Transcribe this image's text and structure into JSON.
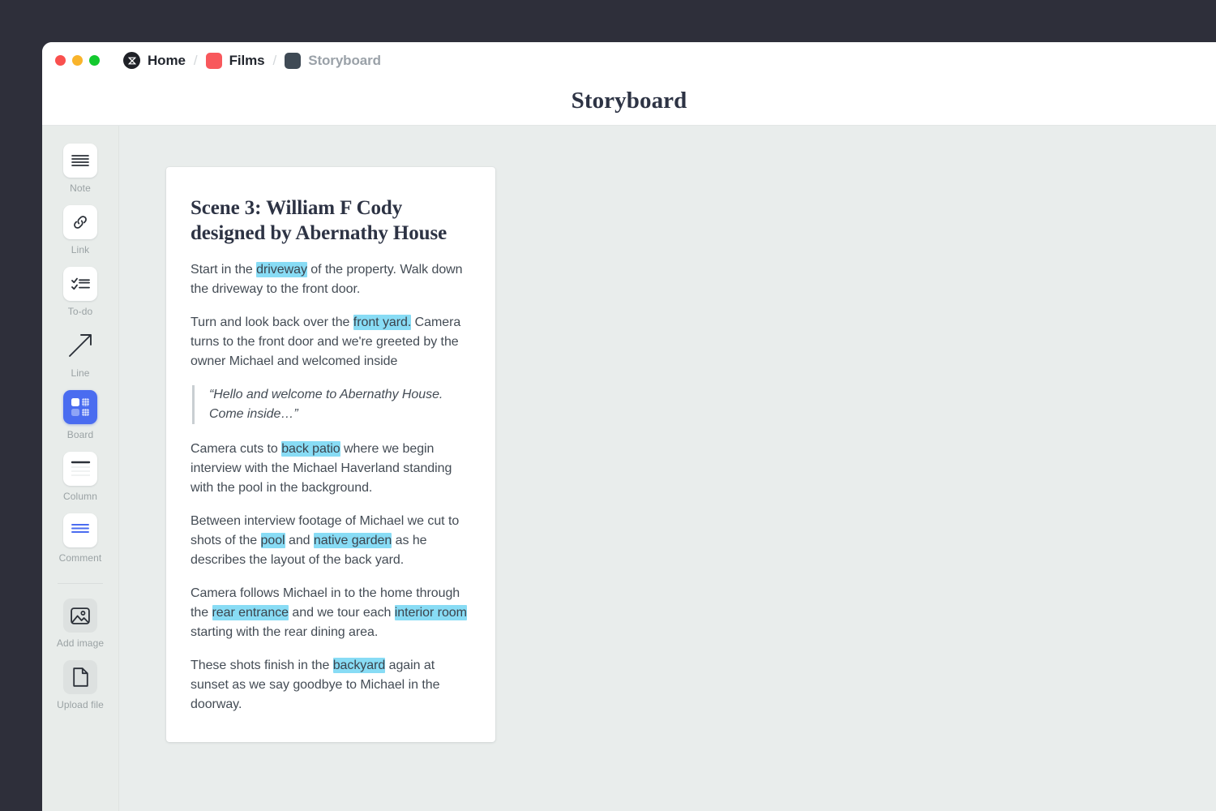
{
  "window": {
    "traffic_lights": [
      "close",
      "minimize",
      "maximize"
    ],
    "breadcrumb": [
      {
        "label": "Home",
        "icon": "home-mark-icon",
        "muted": false
      },
      {
        "label": "Films",
        "icon": "red-square-icon",
        "muted": false
      },
      {
        "label": "Storyboard",
        "icon": "slate-square-icon",
        "muted": true
      }
    ],
    "separator": "/",
    "page_title": "Storyboard"
  },
  "sidebar": {
    "tools": [
      {
        "label": "Note",
        "icon": "note-icon",
        "style": "white"
      },
      {
        "label": "Link",
        "icon": "link-icon",
        "style": "white"
      },
      {
        "label": "To-do",
        "icon": "todo-icon",
        "style": "white"
      },
      {
        "label": "Line",
        "icon": "arrow-line-icon",
        "style": "plain"
      },
      {
        "label": "Board",
        "icon": "board-icon",
        "style": "active"
      },
      {
        "label": "Column",
        "icon": "column-icon",
        "style": "white"
      },
      {
        "label": "Comment",
        "icon": "comment-icon",
        "style": "white"
      },
      {
        "label": "Add image",
        "icon": "image-icon",
        "style": "grey"
      },
      {
        "label": "Upload file",
        "icon": "file-icon",
        "style": "grey"
      }
    ]
  },
  "card": {
    "title": "Scene 3: William F Cody designed by Abernathy House",
    "p1_a": "Start in the ",
    "p1_hl": "driveway",
    "p1_b": " of the property. Walk down the driveway to the front door.",
    "p2_a": "Turn and look back over the ",
    "p2_hl": "front yard.",
    "p2_b": " Camera turns to the front door and we're greeted by the owner Michael and welcomed inside",
    "quote": "“Hello and welcome to Abernathy House. Come inside…”",
    "p3_a": "Camera cuts to ",
    "p3_hl": "back patio",
    "p3_b": " where we begin interview with the Michael Haverland standing with the pool in the background.",
    "p4_a": "Between interview footage of Michael we cut to shots of the ",
    "p4_hl1": "pool",
    "p4_mid": " and ",
    "p4_hl2": "native garden",
    "p4_b": " as he describes the layout of the back yard.",
    "p5_a": "Camera follows Michael in to the home through the ",
    "p5_hl1": "rear entrance",
    "p5_mid": " and we tour each ",
    "p5_hl2": "interior room",
    "p5_b": " starting with the rear dining area.",
    "p6_a": "These shots finish in the ",
    "p6_hl": "backyard",
    "p6_b": " again at sunset as we say goodbye to Michael in the doorway."
  },
  "colors": {
    "desktop": "#2e2f3a",
    "canvas": "#e9edec",
    "highlight": "#88dcf5",
    "accent_blue": "#4a6cf0",
    "films_red": "#f8585c",
    "storyboard_slate": "#3f4a55",
    "title_navy": "#2d3344"
  }
}
